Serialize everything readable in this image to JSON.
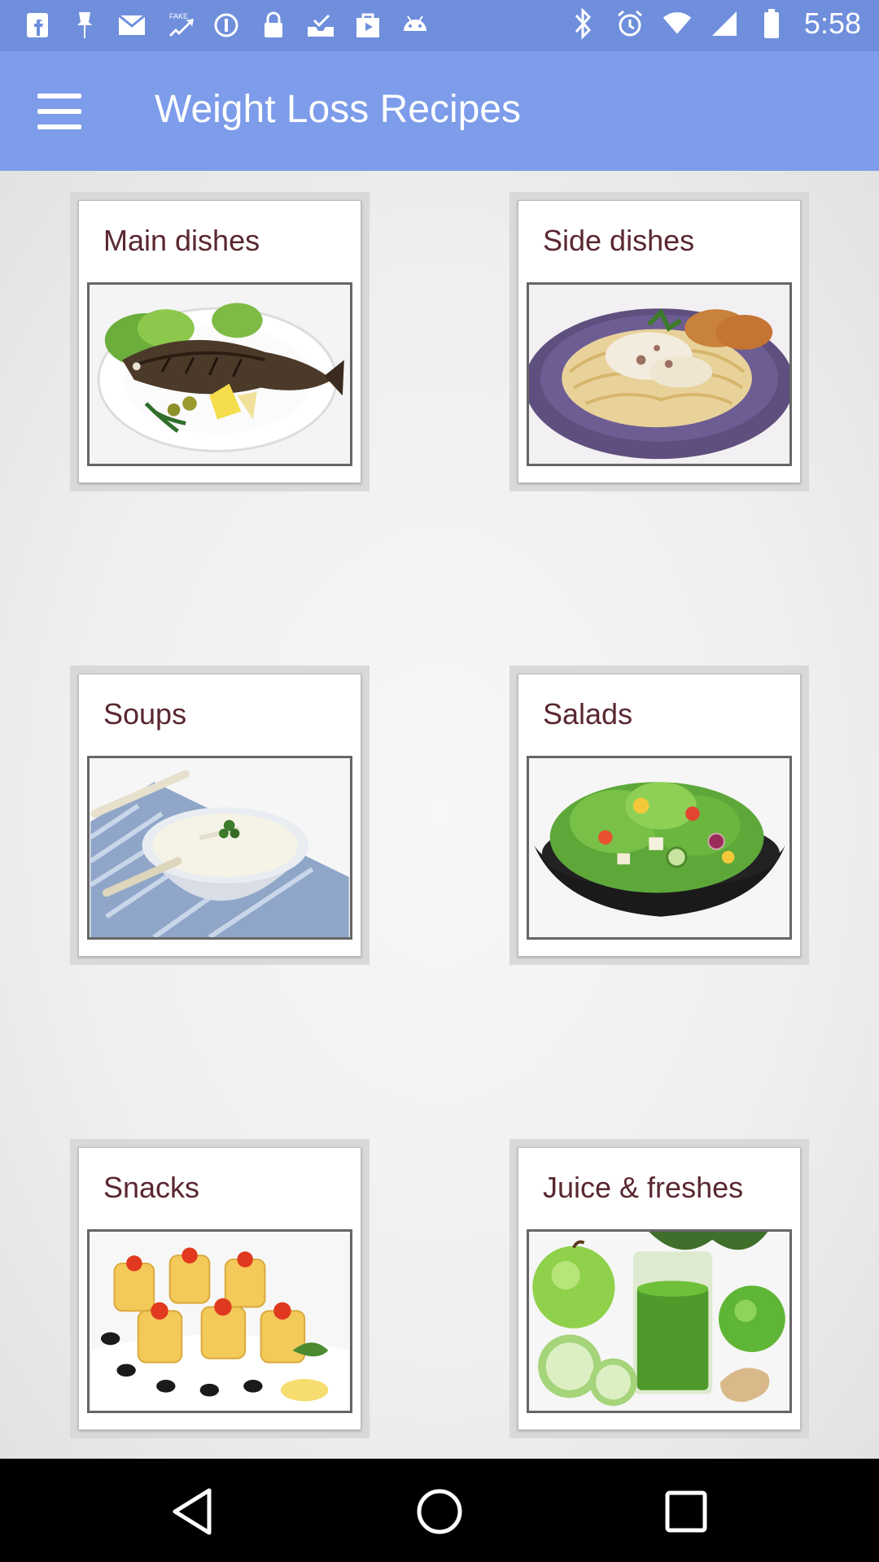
{
  "status_bar": {
    "time": "5:58",
    "left_icons": [
      "facebook-icon",
      "pin-icon",
      "mail-icon",
      "fake-gps-icon",
      "info-circle-icon",
      "lock-icon",
      "inbox-check-icon",
      "play-store-icon",
      "android-icon"
    ],
    "right_icons": [
      "bluetooth-icon",
      "alarm-icon",
      "wifi-icon",
      "signal-icon",
      "battery-icon"
    ]
  },
  "app_bar": {
    "title": "Weight Loss Recipes",
    "menu_icon": "hamburger-menu-icon"
  },
  "categories": [
    {
      "label": "Main dishes",
      "photo": "grilled-fish-plate"
    },
    {
      "label": "Side dishes",
      "photo": "spaghetti-cream-sauce"
    },
    {
      "label": "Soups",
      "photo": "cream-soup-bowl"
    },
    {
      "label": "Salads",
      "photo": "green-salad-bowl"
    },
    {
      "label": "Snacks",
      "photo": "pastry-rolls-caviar"
    },
    {
      "label": "Juice & freshes",
      "photo": "green-smoothie-apple"
    }
  ],
  "nav_bar": {
    "back_icon": "back-triangle-icon",
    "home_icon": "home-circle-icon",
    "recents_icon": "recents-square-icon"
  },
  "colors": {
    "status_bar": "#6f8fdc",
    "app_bar": "#7d9cea",
    "label_text": "#5a2730"
  }
}
